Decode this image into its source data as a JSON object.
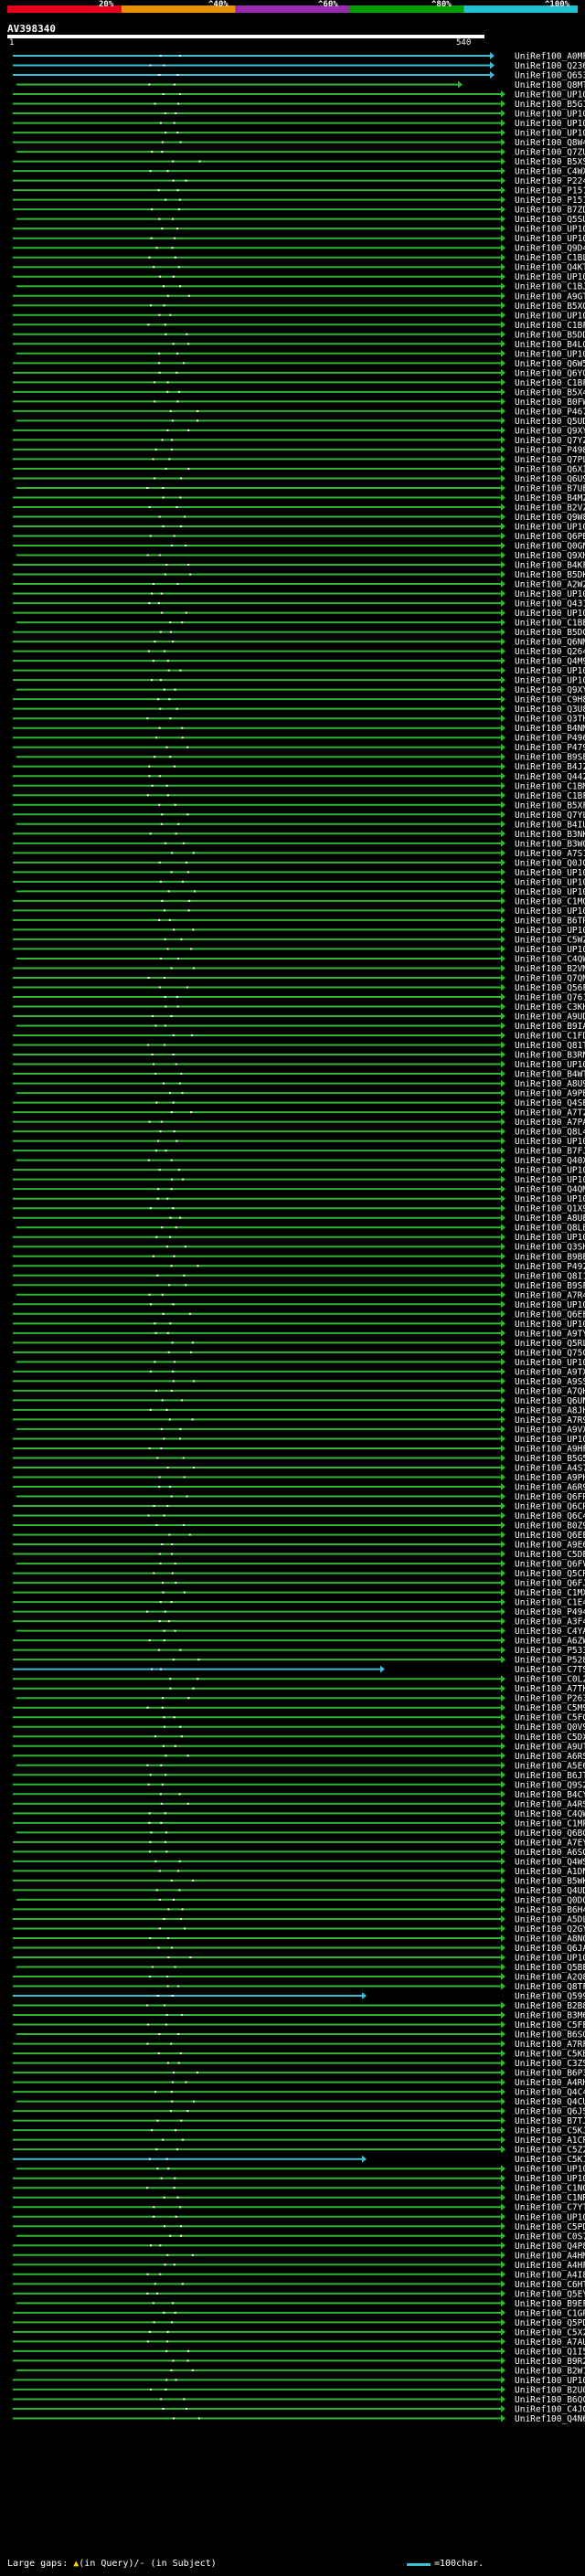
{
  "legend": {
    "colors": [
      "#e8001c",
      "#e89000",
      "#9a2ab0",
      "#00a000",
      "#20c0d0"
    ],
    "labels": [
      "20%",
      "^40%",
      "^60%",
      "^80%",
      "^100%"
    ]
  },
  "query": {
    "name": "AV398340",
    "start": "1",
    "end": "540"
  },
  "hits": [
    "UniRef100_A0MF55",
    "UniRef100_Q23608",
    "UniRef100_Q65353",
    "UniRef100_Q8MTM3",
    "UniRef100_UP1000...",
    "UniRef100_B5G174",
    "UniRef100_UP1000...",
    "UniRef100_UP1000...",
    "UniRef100_UP1000...",
    "UniRef100_Q8W417",
    "UniRef100_Q7ZUI0",
    "UniRef100_B5XSS8",
    "UniRef100_C4WX07",
    "UniRef100_P22451",
    "UniRef100_P15126",
    "UniRef100_P15125",
    "UniRef100_B7ZDE4",
    "UniRef100_Q5SUE7",
    "UniRef100_UP1000...",
    "UniRef100_UP1000...",
    "UniRef100_Q9D4Y7",
    "UniRef100_C1BLC4",
    "UniRef100_Q4KT13",
    "UniRef100_UP1000...",
    "UniRef100_C1BJ74",
    "UniRef100_A9GTT8",
    "UniRef100_B5XG29",
    "UniRef100_UP1000...",
    "UniRef100_C1BFB7",
    "UniRef100_B5DDH0",
    "UniRef100_B4LQQ5",
    "UniRef100_UP1000...",
    "UniRef100_Q6W5Q2",
    "UniRef100_Q6YQB1",
    "UniRef100_C1BF77",
    "UniRef100_B5X413",
    "UniRef100_B0FWK5",
    "UniRef100_P46777",
    "UniRef100_Q5UDW5",
    "UniRef100_Q9XYM6",
    "UniRef100_Q7YZT1",
    "UniRef100_P49885",
    "UniRef100_Q7PL68",
    "UniRef100_Q6XIM1",
    "UniRef100_Q6U9Y2",
    "UniRef100_B7UEB4",
    "UniRef100_B4MZH3",
    "UniRef100_B2VZ25",
    "UniRef100_Q9W8K6",
    "UniRef100_UP1000...",
    "UniRef100_Q6PBE3",
    "UniRef100_Q0GN71",
    "UniRef100_Q9XHM6",
    "UniRef100_B4KFT7",
    "UniRef100_B5DK39",
    "UniRef100_A2W2C3",
    "UniRef100_UP1000...",
    "UniRef100_Q43138",
    "UniRef100_UP1000...",
    "UniRef100_C1BEQ7",
    "UniRef100_B5DGK8",
    "UniRef100_Q6NMY6",
    "UniRef100_Q26481",
    "UniRef100_Q4M9M0",
    "UniRef100_UP1000...",
    "UniRef100_UP1000...",
    "UniRef100_Q9XYW8",
    "UniRef100_C9H8E8",
    "UniRef100_Q3U850",
    "UniRef100_Q3TKR5",
    "UniRef100_B4NMK8",
    "UniRef100_P49629",
    "UniRef100_P47962",
    "UniRef100_B9SEY9",
    "UniRef100_B4J219",
    "UniRef100_Q44248",
    "UniRef100_C1BM02",
    "UniRef100_C1BF17",
    "UniRef100_B5XFW1",
    "UniRef100_Q7YL67",
    "UniRef100_B4IUU1",
    "UniRef100_B3NKK9",
    "UniRef100_B3W025",
    "UniRef100_A7S119",
    "UniRef100_Q0JGY1",
    "UniRef100_UP1000...",
    "UniRef100_UP1000...",
    "UniRef100_UP1000...",
    "UniRef100_C1MQU2",
    "UniRef100_UP1000...",
    "UniRef100_B6TR69",
    "UniRef100_UP1000...",
    "UniRef100_C5WZW1",
    "UniRef100_UP1000...",
    "UniRef100_C4QWD5",
    "UniRef100_B2VMY0",
    "UniRef100_Q7QMP1",
    "UniRef100_Q56F66",
    "UniRef100_Q76190",
    "UniRef100_C3KHF7",
    "UniRef100_A9UDR2",
    "UniRef100_B9IA24",
    "UniRef100_C1FDL0",
    "UniRef100_Q81TA8",
    "UniRef100_B3RNF8",
    "UniRef100_UP1000...",
    "UniRef100_B4WTL2",
    "UniRef100_A8U9N9",
    "UniRef100_A9PB43",
    "UniRef100_Q4SEW0",
    "UniRef100_A7T2Z7",
    "UniRef100_A7PAM1",
    "UniRef100_Q8L4L4",
    "UniRef100_UP1000...",
    "UniRef100_B7FJX5",
    "UniRef100_Q40XN2",
    "UniRef100_UP1000...",
    "UniRef100_UP1000...",
    "UniRef100_Q4QMN3",
    "UniRef100_UP1000...",
    "UniRef100_Q1X9D8",
    "UniRef100_A8UEW1",
    "UniRef100_Q8LB11",
    "UniRef100_UP1000...",
    "UniRef100_Q3SHU5",
    "UniRef100_B9BEM3",
    "UniRef100_P49227",
    "UniRef100_Q8I1I4",
    "UniRef100_B9SFU0",
    "UniRef100_A7R4R2",
    "UniRef100_UP1000...",
    "UniRef100_Q6EE83",
    "UniRef100_UP1000...",
    "UniRef100_A9TYC5",
    "UniRef100_Q5RLY8",
    "UniRef100_Q75C13",
    "UniRef100_UP1000...",
    "UniRef100_A9TXS7",
    "UniRef100_A9SS13",
    "UniRef100_A7QHY5",
    "UniRef100_Q6UNT2",
    "UniRef100_A8JHA7",
    "UniRef100_A7R9S0",
    "UniRef100_A9VXI1",
    "UniRef100_UP1000...",
    "UniRef100_A9HFA0",
    "UniRef100_B5G5Y2",
    "UniRef100_A4S7M6",
    "UniRef100_A9PH69",
    "UniRef100_A6R929",
    "UniRef100_Q6FRF9",
    "UniRef100_Q6CRR9",
    "UniRef100_Q6C428",
    "UniRef100_B0Z9K8",
    "UniRef100_Q6EE82",
    "UniRef100_A9E698",
    "UniRef100_C5DE06",
    "UniRef100_Q6FVD7",
    "UniRef100_Q5CRR7",
    "UniRef100_Q6FJY0",
    "UniRef100_C1MXG8",
    "UniRef100_C1E4X6",
    "UniRef100_P49405",
    "UniRef100_A3F434",
    "UniRef100_C4YAT9",
    "UniRef100_A6ZWE1",
    "UniRef100_P53306",
    "UniRef100_P52822",
    "UniRef100_C7TS56",
    "UniRef100_C0L227",
    "UniRef100_A7TKG5",
    "UniRef100_P26321",
    "UniRef100_C5M9AZ",
    "UniRef100_C5FG14",
    "UniRef100_Q0V9V2",
    "UniRef100_C5DXN6",
    "UniRef100_A9UT63",
    "UniRef100_A6RSA9",
    "UniRef100_A5E640",
    "UniRef100_B6JTH7",
    "UniRef100_Q9S2T6",
    "UniRef100_B4CYD9",
    "UniRef100_A4RSV9",
    "UniRef100_C4QWU8",
    "UniRef100_C1MPX4",
    "UniRef100_Q6BGU2",
    "UniRef100_A7EYV0",
    "UniRef100_A6SGL6",
    "UniRef100_Q4WS55",
    "UniRef100_A1DN72",
    "UniRef100_B5WKS3",
    "UniRef100_Q4UDE7",
    "UniRef100_Q0DQ33",
    "UniRef100_B6H423",
    "UniRef100_A5DL86",
    "UniRef100_Q2GYQ4",
    "UniRef100_A8N0D9",
    "UniRef100_Q6JAM5",
    "UniRef100_UP1000...",
    "UniRef100_Q5BEL7",
    "UniRef100_A2Q8E4",
    "UniRef100_Q8TFY0",
    "UniRef100_Q59953",
    "UniRef100_B2B802",
    "UniRef100_B3M696",
    "UniRef100_C5FEH2",
    "UniRef100_B6SQF0",
    "UniRef100_A7RF59",
    "UniRef100_C5KB00",
    "UniRef100_C3ZS34",
    "UniRef100_B6P326",
    "UniRef100_A4RHO5",
    "UniRef100_Q4C4G1",
    "UniRef100_Q4CUQ9",
    "UniRef100_Q6JS59",
    "UniRef100_B7TJH5",
    "UniRef100_C5KJU2",
    "UniRef100_A1CPH2",
    "UniRef100_C5Z2L2",
    "UniRef100_C5K146",
    "UniRef100_UP1000...",
    "UniRef100_UP1000...",
    "UniRef100_C1N0H8",
    "UniRef100_C1NRD6",
    "UniRef100_C7YTC1",
    "UniRef100_UP1000...",
    "UniRef100_C5PDX6",
    "UniRef100_C0S7B1",
    "UniRef100_Q4P8T2",
    "UniRef100_A4HMK9",
    "UniRef100_A4HFM8",
    "UniRef100_A4I888",
    "UniRef100_C6HTG2",
    "UniRef100_Q5EY89",
    "UniRef100_B9EFM2",
    "UniRef100_C1GPY3",
    "UniRef100_Q5PDD4",
    "UniRef100_C5X265",
    "UniRef100_A7AUD5",
    "UniRef100_Q1I5B9",
    "UniRef100_B9R2C6",
    "UniRef100_B2W1Q9",
    "UniRef100_UP1000...",
    "UniRef100_B2U0Z1",
    "UniRef100_B6QC03",
    "UniRef100_C4JCX7",
    "UniRef100_Q4N6R4"
  ],
  "footer": {
    "large_gaps": "Large gaps: ",
    "large_gaps_detail": "(in Query)/- (in Subject)",
    "scale": "=100char."
  }
}
